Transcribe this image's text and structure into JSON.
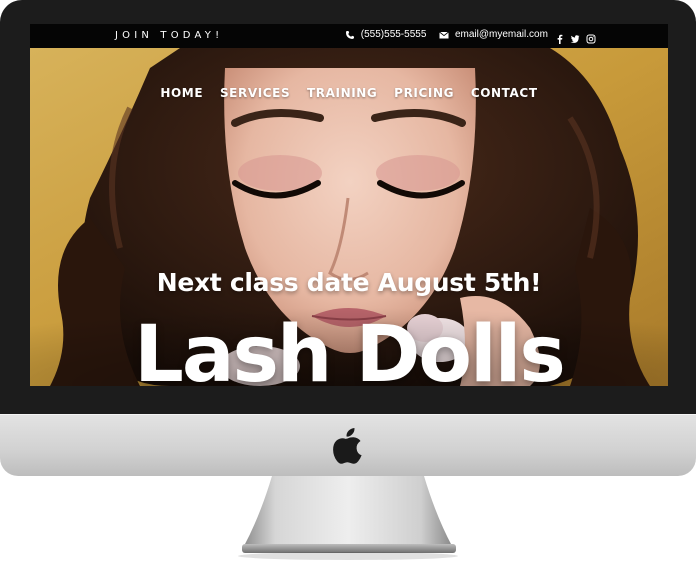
{
  "topbar": {
    "join_label": "JOIN TODAY!",
    "phone": "(555)555-5555",
    "email": "email@myemail.com",
    "social_icons": [
      "facebook-icon",
      "twitter-icon",
      "instagram-icon"
    ]
  },
  "nav": {
    "items": [
      {
        "label": "HOME"
      },
      {
        "label": "SERVICES"
      },
      {
        "label": "TRAINING"
      },
      {
        "label": "PRICING"
      },
      {
        "label": "CONTACT"
      }
    ]
  },
  "hero": {
    "tagline": "Next class date August 5th!",
    "brand": "Lash Dolls"
  },
  "colors": {
    "topbar_bg": "#050505",
    "bezel": "#1c1c1c",
    "hero_gold": "#c69a3c",
    "text": "#ffffff"
  }
}
